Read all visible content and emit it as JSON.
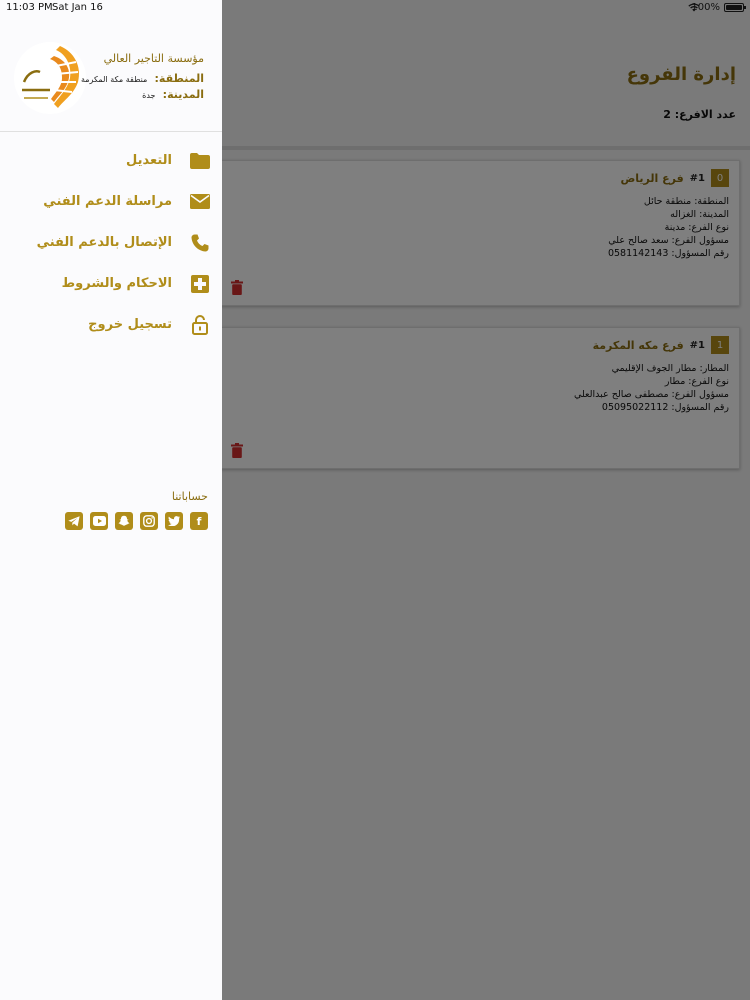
{
  "status": {
    "time": "11:03 PM",
    "date": "Sat Jan 16",
    "battery": "100%",
    "battery_level": 1.0
  },
  "page": {
    "title": "إدارة الفروع",
    "branch_count": "عدد الافرع: 2",
    "branches": [
      {
        "index": "0",
        "num": "#1",
        "name": "فرع الرياض",
        "lines": [
          "المنطقة: منطقة   حائل",
          "المدينة: الغزاله",
          "نوع الفرع: مدينة",
          "مسؤول الفرع: سعد صالح علي",
          "رقم المسؤول: 0581142143"
        ]
      },
      {
        "index": "1",
        "num": "#1",
        "name": "فرع مكه المكرمة",
        "lines": [
          "المطار: مطار الجوف الإقليمي",
          "نوع الفرع: مطار",
          "مسؤول الفرع: مصطفى صالح عبدالعلي",
          "رقم المسؤول: 05095022112"
        ]
      }
    ]
  },
  "drawer": {
    "org_name": "مؤسسة التاجير العالي",
    "region_label": "المنطقة:",
    "region_value": "منطقة مكة المكرمة",
    "city_label": "المدينة:",
    "city_value": "جدة",
    "menu": [
      {
        "label": "التعديل",
        "icon": "folder-icon"
      },
      {
        "label": "مراسلة الدعم الفني",
        "icon": "mail-icon"
      },
      {
        "label": "الإتصال بالدعم الفني",
        "icon": "phone-icon"
      },
      {
        "label": "الاحكام والشروط",
        "icon": "medical-cross-icon"
      },
      {
        "label": "تسجيل خروج",
        "icon": "unlock-icon"
      }
    ],
    "social_title": "حساباتنا",
    "socials": [
      "facebook-icon",
      "twitter-icon",
      "instagram-icon",
      "snapchat-icon",
      "youtube-icon",
      "telegram-icon"
    ]
  },
  "colors": {
    "gold": "#b08d1a",
    "gold_dark": "#8a6d10",
    "danger": "#d32f2f"
  }
}
